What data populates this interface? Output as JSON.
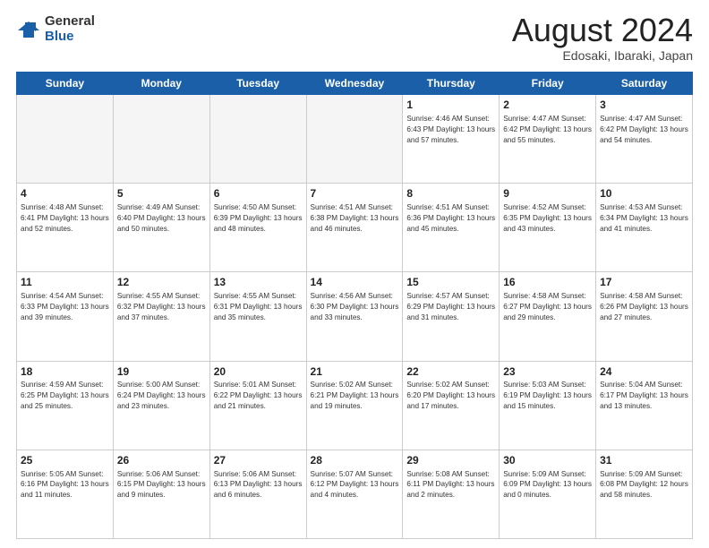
{
  "header": {
    "logo_general": "General",
    "logo_blue": "Blue",
    "month_title": "August 2024",
    "subtitle": "Edosaki, Ibaraki, Japan"
  },
  "days_of_week": [
    "Sunday",
    "Monday",
    "Tuesday",
    "Wednesday",
    "Thursday",
    "Friday",
    "Saturday"
  ],
  "weeks": [
    [
      {
        "day": "",
        "info": ""
      },
      {
        "day": "",
        "info": ""
      },
      {
        "day": "",
        "info": ""
      },
      {
        "day": "",
        "info": ""
      },
      {
        "day": "1",
        "info": "Sunrise: 4:46 AM\nSunset: 6:43 PM\nDaylight: 13 hours\nand 57 minutes."
      },
      {
        "day": "2",
        "info": "Sunrise: 4:47 AM\nSunset: 6:42 PM\nDaylight: 13 hours\nand 55 minutes."
      },
      {
        "day": "3",
        "info": "Sunrise: 4:47 AM\nSunset: 6:42 PM\nDaylight: 13 hours\nand 54 minutes."
      }
    ],
    [
      {
        "day": "4",
        "info": "Sunrise: 4:48 AM\nSunset: 6:41 PM\nDaylight: 13 hours\nand 52 minutes."
      },
      {
        "day": "5",
        "info": "Sunrise: 4:49 AM\nSunset: 6:40 PM\nDaylight: 13 hours\nand 50 minutes."
      },
      {
        "day": "6",
        "info": "Sunrise: 4:50 AM\nSunset: 6:39 PM\nDaylight: 13 hours\nand 48 minutes."
      },
      {
        "day": "7",
        "info": "Sunrise: 4:51 AM\nSunset: 6:38 PM\nDaylight: 13 hours\nand 46 minutes."
      },
      {
        "day": "8",
        "info": "Sunrise: 4:51 AM\nSunset: 6:36 PM\nDaylight: 13 hours\nand 45 minutes."
      },
      {
        "day": "9",
        "info": "Sunrise: 4:52 AM\nSunset: 6:35 PM\nDaylight: 13 hours\nand 43 minutes."
      },
      {
        "day": "10",
        "info": "Sunrise: 4:53 AM\nSunset: 6:34 PM\nDaylight: 13 hours\nand 41 minutes."
      }
    ],
    [
      {
        "day": "11",
        "info": "Sunrise: 4:54 AM\nSunset: 6:33 PM\nDaylight: 13 hours\nand 39 minutes."
      },
      {
        "day": "12",
        "info": "Sunrise: 4:55 AM\nSunset: 6:32 PM\nDaylight: 13 hours\nand 37 minutes."
      },
      {
        "day": "13",
        "info": "Sunrise: 4:55 AM\nSunset: 6:31 PM\nDaylight: 13 hours\nand 35 minutes."
      },
      {
        "day": "14",
        "info": "Sunrise: 4:56 AM\nSunset: 6:30 PM\nDaylight: 13 hours\nand 33 minutes."
      },
      {
        "day": "15",
        "info": "Sunrise: 4:57 AM\nSunset: 6:29 PM\nDaylight: 13 hours\nand 31 minutes."
      },
      {
        "day": "16",
        "info": "Sunrise: 4:58 AM\nSunset: 6:27 PM\nDaylight: 13 hours\nand 29 minutes."
      },
      {
        "day": "17",
        "info": "Sunrise: 4:58 AM\nSunset: 6:26 PM\nDaylight: 13 hours\nand 27 minutes."
      }
    ],
    [
      {
        "day": "18",
        "info": "Sunrise: 4:59 AM\nSunset: 6:25 PM\nDaylight: 13 hours\nand 25 minutes."
      },
      {
        "day": "19",
        "info": "Sunrise: 5:00 AM\nSunset: 6:24 PM\nDaylight: 13 hours\nand 23 minutes."
      },
      {
        "day": "20",
        "info": "Sunrise: 5:01 AM\nSunset: 6:22 PM\nDaylight: 13 hours\nand 21 minutes."
      },
      {
        "day": "21",
        "info": "Sunrise: 5:02 AM\nSunset: 6:21 PM\nDaylight: 13 hours\nand 19 minutes."
      },
      {
        "day": "22",
        "info": "Sunrise: 5:02 AM\nSunset: 6:20 PM\nDaylight: 13 hours\nand 17 minutes."
      },
      {
        "day": "23",
        "info": "Sunrise: 5:03 AM\nSunset: 6:19 PM\nDaylight: 13 hours\nand 15 minutes."
      },
      {
        "day": "24",
        "info": "Sunrise: 5:04 AM\nSunset: 6:17 PM\nDaylight: 13 hours\nand 13 minutes."
      }
    ],
    [
      {
        "day": "25",
        "info": "Sunrise: 5:05 AM\nSunset: 6:16 PM\nDaylight: 13 hours\nand 11 minutes."
      },
      {
        "day": "26",
        "info": "Sunrise: 5:06 AM\nSunset: 6:15 PM\nDaylight: 13 hours\nand 9 minutes."
      },
      {
        "day": "27",
        "info": "Sunrise: 5:06 AM\nSunset: 6:13 PM\nDaylight: 13 hours\nand 6 minutes."
      },
      {
        "day": "28",
        "info": "Sunrise: 5:07 AM\nSunset: 6:12 PM\nDaylight: 13 hours\nand 4 minutes."
      },
      {
        "day": "29",
        "info": "Sunrise: 5:08 AM\nSunset: 6:11 PM\nDaylight: 13 hours\nand 2 minutes."
      },
      {
        "day": "30",
        "info": "Sunrise: 5:09 AM\nSunset: 6:09 PM\nDaylight: 13 hours\nand 0 minutes."
      },
      {
        "day": "31",
        "info": "Sunrise: 5:09 AM\nSunset: 6:08 PM\nDaylight: 12 hours\nand 58 minutes."
      }
    ]
  ]
}
